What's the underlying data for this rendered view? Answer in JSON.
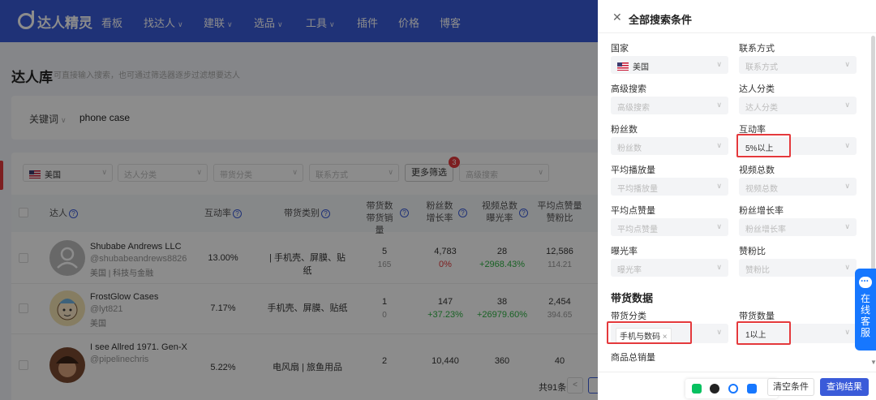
{
  "app": {
    "brand": "达人精灵",
    "accent": "#3a5bd9",
    "alert": "#e4393c"
  },
  "nav": {
    "items": [
      {
        "label": "看板",
        "caret": false
      },
      {
        "label": "找达人",
        "caret": true
      },
      {
        "label": "建联",
        "caret": true
      },
      {
        "label": "选品",
        "caret": true
      },
      {
        "label": "工具",
        "caret": true
      },
      {
        "label": "插件",
        "caret": false
      },
      {
        "label": "价格",
        "caret": false
      },
      {
        "label": "博客",
        "caret": false
      }
    ]
  },
  "page": {
    "title": "达人库",
    "subtitle": "可直接输入搜索，也可通过筛选器逐步过滤想要达人"
  },
  "search": {
    "keyword_label": "关键词",
    "keyword_value": "phone case"
  },
  "filters": {
    "country": "美国",
    "category_placeholder": "达人分类",
    "goods_placeholder": "带货分类",
    "contact_placeholder": "联系方式",
    "more_label": "更多筛选",
    "more_badge": "3",
    "advanced_placeholder": "高级搜索"
  },
  "table": {
    "headers": {
      "creator": "达人",
      "engagement": "互动率",
      "goods_category": "带货类别",
      "goods_count_1": "带货数",
      "goods_count_2": "带货销量",
      "followers_1": "粉丝数",
      "followers_2": "增长率",
      "videos_1": "视频总数",
      "videos_2": "曝光率",
      "likes_1": "平均点赞量",
      "likes_2": "赞粉比"
    },
    "rows": [
      {
        "name": "Shubabe Andrews LLC",
        "handle": "@shubabeandrews8826",
        "meta": "美国 | 科技与金融",
        "engagement": "13.00%",
        "goods_category": "| 手机壳、屏膜、贴纸",
        "goods": "5",
        "sales": "165",
        "followers": "4,783",
        "growth": "0%",
        "growth_color": "red",
        "videos": "28",
        "exposure": "+2968.43%",
        "likes": "12,586",
        "ratio": "114.21"
      },
      {
        "name": "FrostGlow Cases",
        "handle": "@lyt821",
        "meta": "美国",
        "engagement": "7.17%",
        "goods_category": "手机壳、屏膜、贴纸",
        "goods": "1",
        "sales": "0",
        "followers": "147",
        "growth": "+37.23%",
        "growth_color": "green",
        "videos": "38",
        "exposure": "+26979.60%",
        "likes": "2,454",
        "ratio": "394.65"
      },
      {
        "name": "I see Allred 1971. Gen-X",
        "handle": "@pipelinechris",
        "meta": "",
        "engagement": "5.22%",
        "goods_category": "电风扇 | 旅鱼用品",
        "goods": "2",
        "sales": "",
        "followers": "10,440",
        "growth": "",
        "growth_color": "",
        "videos": "360",
        "exposure": "",
        "likes": "40",
        "ratio": ""
      }
    ],
    "total": "共91条"
  },
  "drawer": {
    "title": "全部搜索条件",
    "fields": {
      "country_label": "国家",
      "country_value": "美国",
      "contact_label": "联系方式",
      "contact_ph": "联系方式",
      "adv_label": "高级搜索",
      "adv_ph": "高级搜索",
      "cat_label": "达人分类",
      "cat_ph": "达人分类",
      "fans_label": "粉丝数",
      "fans_ph": "粉丝数",
      "eng_label": "互动率",
      "eng_value": "5%以上",
      "play_label": "平均播放量",
      "play_ph": "平均播放量",
      "vid_label": "视频总数",
      "vid_ph": "视频总数",
      "like_label": "平均点赞量",
      "like_ph": "平均点赞量",
      "growth_label": "粉丝增长率",
      "growth_ph": "粉丝增长率",
      "expo_label": "曝光率",
      "expo_ph": "曝光率",
      "ratio_label": "赞粉比",
      "ratio_ph": "赞粉比"
    },
    "section": "带货数据",
    "goods_cat_label": "带货分类",
    "goods_cat_tag": "手机与数码",
    "goods_num_label": "带货数量",
    "goods_num_value": "1以上",
    "total_sales_label": "商品总销量",
    "clear_label": "清空条件",
    "query_label": "查询结果"
  },
  "service": {
    "label": "在线客服"
  }
}
